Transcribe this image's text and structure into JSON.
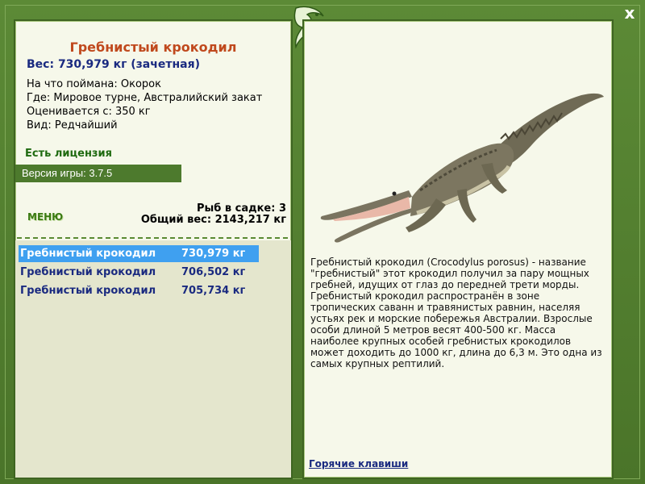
{
  "close_label": "x",
  "catch": {
    "title": "Гребнистый крокодил",
    "weight": "Вес: 730,979 кг (зачетная)",
    "bait": "На что поймана: Окорок",
    "location": "Где: Мировое турне, Австралийский закат",
    "valued_from": "Оценивается с: 350 кг",
    "kind": "Вид: Редчайший"
  },
  "licence": "Есть лицензия",
  "version": "Версия игры: 3.7.5",
  "menu_label": "МЕНЮ",
  "cage": {
    "fish_count": "Рыб в садке: 3",
    "total_weight": "Общий вес: 2143,217 кг"
  },
  "catch_list": [
    {
      "name": "Гребнистый крокодил",
      "weight": "730,979 кг",
      "selected": true
    },
    {
      "name": "Гребнистый крокодил",
      "weight": "706,502 кг",
      "selected": false
    },
    {
      "name": "Гребнистый крокодил",
      "weight": "705,734 кг",
      "selected": false
    }
  ],
  "description": "Гребнистый крокодил (Crocodylus porosus) - название \"гребнистый\" этот крокодил получил за пару мощных гребней, идущих от глаз до передней трети морды. Гребнистый крокодил распространён в зоне тропических саванн и травянистых равнин, населяя устьях рек и морские побережья Австралии. Взрослые особи длиной 5 метров весят 400-500 кг. Масса наиболее крупных особей гребнистых крокодилов может доходить до 1000 кг, длина до 6,3 м. Это одна из самых крупных рептилий.",
  "hotkeys_label": "Горячие клавиши",
  "colors": {
    "frame_green": "#4e7a2e",
    "panel_bg": "#f6f8ea",
    "title_orange": "#c0491d",
    "link_blue": "#1a2a80",
    "selected_row": "#3fa0f0"
  }
}
